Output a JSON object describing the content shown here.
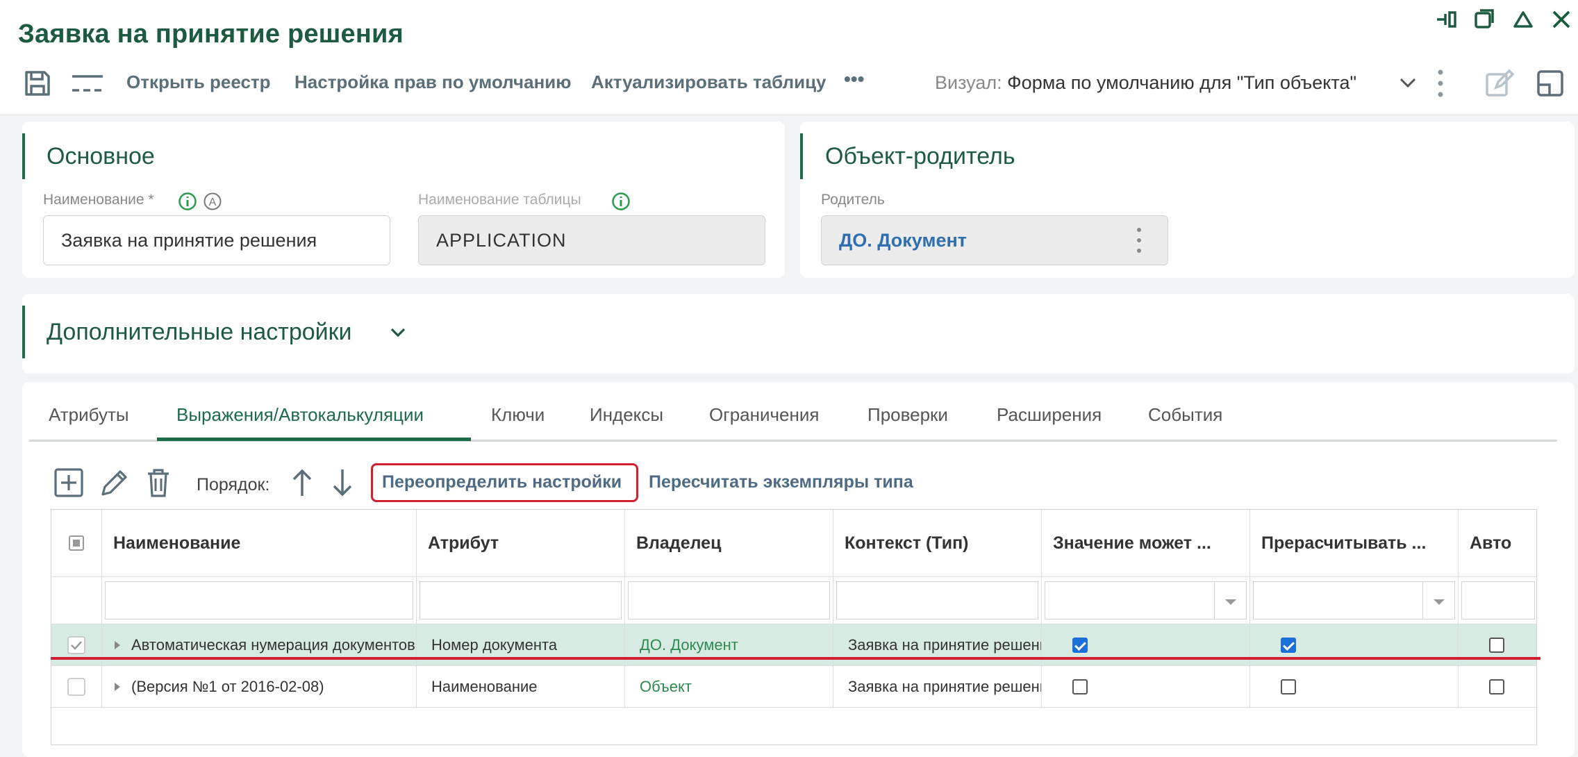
{
  "window": {
    "title": "Заявка на принятие решения",
    "icons": [
      "pin-icon",
      "restore-icon",
      "collapse-icon",
      "close-icon"
    ]
  },
  "toolbar": {
    "open_registry": "Открыть реестр",
    "default_rights": "Настройка прав по умолчанию",
    "refresh_table": "Актуализировать таблицу",
    "more": "•••",
    "view_label": "Визуал:",
    "view_value": "Форма по умолчанию для \"Тип объекта\""
  },
  "main_section": {
    "title": "Основное",
    "name_label": "Наименование *",
    "name_value": "Заявка на принятие решения",
    "table_name_label": "Наименование таблицы",
    "table_name_value": "APPLICATION"
  },
  "parent_section": {
    "title": "Объект-родитель",
    "parent_label": "Родитель",
    "parent_value": "ДО. Документ"
  },
  "extra_section": {
    "title": "Дополнительные настройки"
  },
  "tabs": [
    {
      "label": "Атрибуты",
      "active": false
    },
    {
      "label": "Выражения/Автокалькуляции",
      "active": true
    },
    {
      "label": "Ключи",
      "active": false
    },
    {
      "label": "Индексы",
      "active": false
    },
    {
      "label": "Ограничения",
      "active": false
    },
    {
      "label": "Проверки",
      "active": false
    },
    {
      "label": "Расширения",
      "active": false
    },
    {
      "label": "События",
      "active": false
    }
  ],
  "grid_toolbar": {
    "order_label": "Порядок:",
    "override_settings": "Переопределить настройки",
    "recalc_instances": "Пересчитать экземпляры типа"
  },
  "grid": {
    "columns": [
      "Наименование",
      "Атрибут",
      "Владелец",
      "Контекст (Тип)",
      "Значение может ...",
      "Прерасчитывать ...",
      "Авто"
    ],
    "rows": [
      {
        "selected": true,
        "name": "Автоматическая нумерация документов",
        "attribute": "Номер документа",
        "owner": "ДО. Документ",
        "context": "Заявка на принятие решения",
        "can_change": true,
        "recalc": true,
        "auto": false
      },
      {
        "selected": false,
        "name": "(Версия №1 от 2016-02-08)",
        "attribute": "Наименование",
        "owner": "Объект",
        "context": "Заявка на принятие решения",
        "can_change": false,
        "recalc": false,
        "auto": false
      }
    ]
  },
  "colors": {
    "accent_green": "#1d5b40",
    "highlight_red": "#d0202f",
    "selected_row": "#d8ebe2",
    "link_blue": "#2f6fb0"
  }
}
